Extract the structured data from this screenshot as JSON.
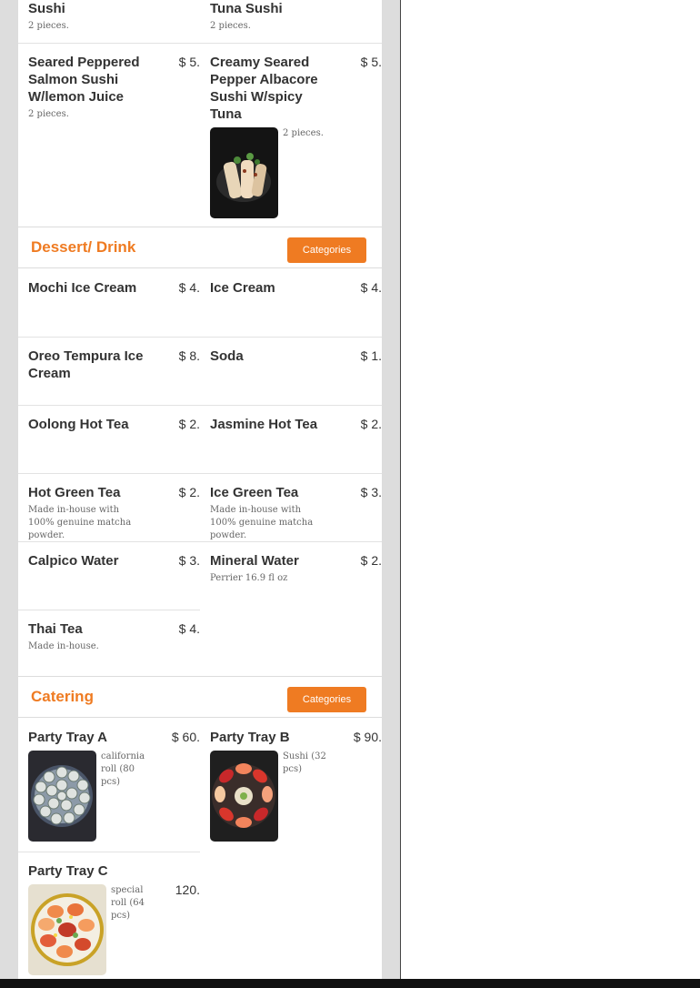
{
  "colors": {
    "accent": "#ef7b22",
    "gutter": "#dddddd"
  },
  "top_items": [
    {
      "name": "Sushi",
      "desc": "2 pieces."
    },
    {
      "name": "Tuna Sushi",
      "desc": "2 pieces."
    }
  ],
  "nigiri": [
    {
      "name": "Seared Peppered Salmon Sushi W/lemon Juice",
      "price": "$ 5.",
      "desc": "2 pieces."
    },
    {
      "name": "Creamy Seared Pepper Albacore Sushi W/spicy Tuna",
      "price": "$ 5.",
      "desc": "2 pieces.",
      "image": "sushi-photo"
    }
  ],
  "dessert": {
    "title": "Dessert/ Drink",
    "categories_label": "Categories",
    "items": [
      {
        "name": "Mochi Ice Cream",
        "price": "$ 4."
      },
      {
        "name": "Ice Cream",
        "price": "$ 4."
      },
      {
        "name": "Oreo Tempura Ice Cream",
        "price": "$ 8."
      },
      {
        "name": "Soda",
        "price": "$ 1."
      },
      {
        "name": "Oolong Hot Tea",
        "price": "$ 2."
      },
      {
        "name": "Jasmine Hot Tea",
        "price": "$ 2."
      },
      {
        "name": "Hot Green Tea",
        "price": "$ 2.",
        "desc": "Made in-house with 100% genuine matcha powder."
      },
      {
        "name": "Ice Green Tea",
        "price": "$ 3.",
        "desc": "Made in-house with 100% genuine matcha powder."
      },
      {
        "name": "Calpico Water",
        "price": "$ 3."
      },
      {
        "name": "Mineral Water",
        "price": "$ 2.",
        "desc": "Perrier 16.9 fl oz"
      },
      {
        "name": "Thai Tea",
        "price": "$ 4.",
        "desc": "Made in-house."
      }
    ]
  },
  "catering": {
    "title": "Catering",
    "categories_label": "Categories",
    "items": [
      {
        "name": "Party Tray A",
        "price": "$ 60.",
        "desc": "california roll (80 pcs)",
        "image": "california-roll-tray-photo"
      },
      {
        "name": "Party Tray B",
        "price": "$ 90.",
        "desc": "Sushi (32 pcs)",
        "image": "sushi-tray-photo"
      },
      {
        "name": "Party Tray C",
        "price": "120.",
        "desc": "special roll (64 pcs)",
        "image": "special-roll-tray-photo"
      }
    ]
  }
}
